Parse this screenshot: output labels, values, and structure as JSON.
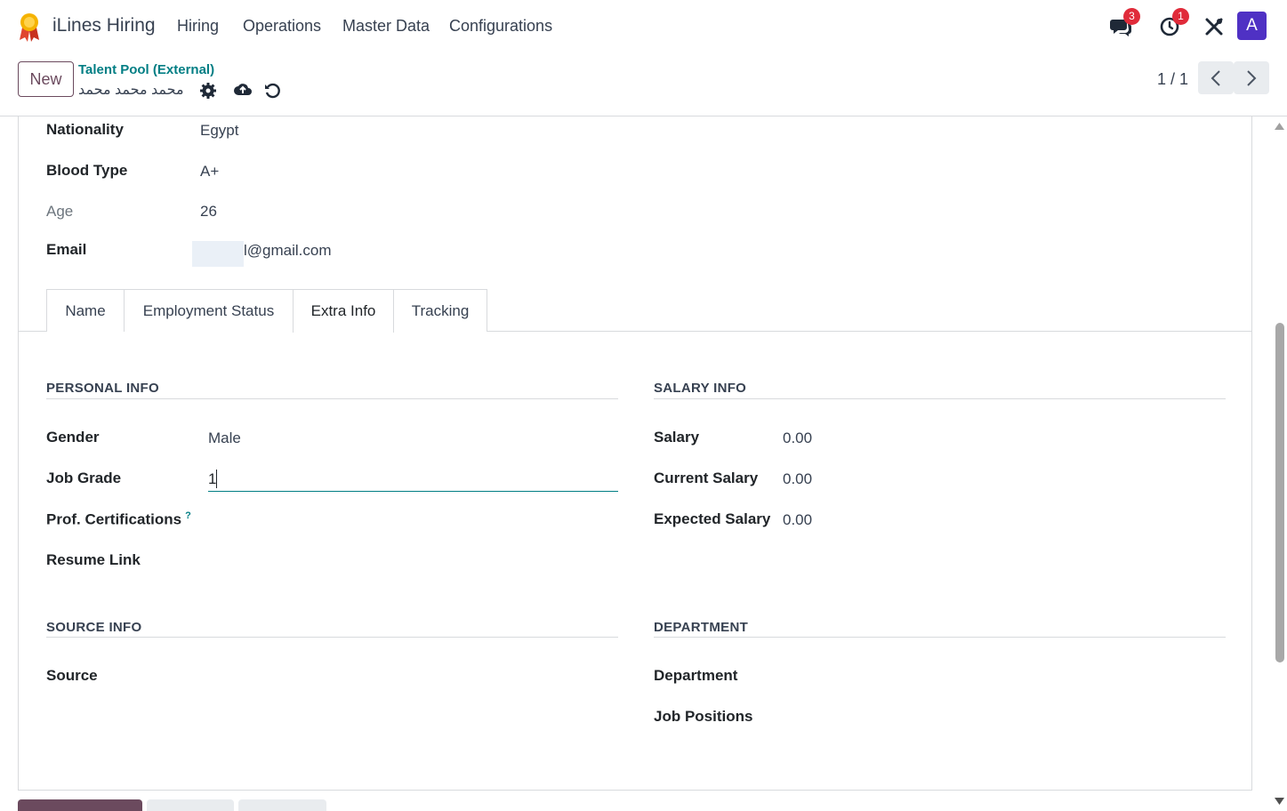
{
  "navbar": {
    "app_name": "iLines Hiring",
    "menus": [
      "Hiring",
      "Operations",
      "Master Data",
      "Configurations"
    ],
    "messages_badge": "3",
    "activities_badge": "1",
    "avatar_letter": "A"
  },
  "control": {
    "new_label": "New",
    "breadcrumb": "Talent Pool (External)",
    "record_name": "محمد محمد محمد",
    "pager": "1 / 1"
  },
  "top_fields": {
    "nationality_label": "Nationality",
    "nationality_value": "Egypt",
    "blood_label": "Blood Type",
    "blood_value": "A+",
    "age_label": "Age",
    "age_value": "26",
    "email_label": "Email",
    "email_value": "l@gmail.com"
  },
  "tabs": [
    "Name",
    "Employment Status",
    "Extra Info",
    "Tracking"
  ],
  "active_tab": "Extra Info",
  "personal": {
    "title": "PERSONAL INFO",
    "gender_label": "Gender",
    "gender_value": "Male",
    "job_grade_label": "Job Grade",
    "job_grade_value": "1",
    "certs_label": "Prof. Certifications",
    "certs_help": "?",
    "resume_label": "Resume Link"
  },
  "salary": {
    "title": "SALARY INFO",
    "salary_label": "Salary",
    "salary_value": "0.00",
    "current_label": "Current Salary",
    "current_value": "0.00",
    "expected_label": "Expected Salary",
    "expected_value": "0.00"
  },
  "source": {
    "title": "SOURCE INFO",
    "source_label": "Source"
  },
  "department": {
    "title": "DEPARTMENT",
    "department_label": "Department",
    "positions_label": "Job Positions"
  },
  "colors": {
    "accent": "#017e84",
    "brand": "#6b4a5e",
    "avatar": "#4f31c4",
    "badge": "#e02b3a"
  }
}
